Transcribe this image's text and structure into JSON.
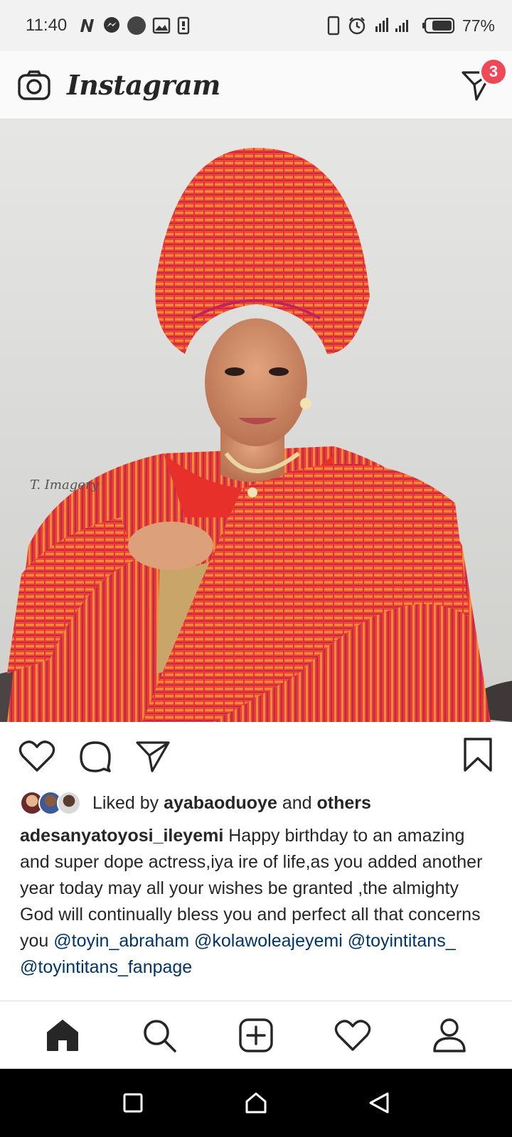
{
  "status_bar": {
    "time": "11:40",
    "notification_icons": [
      "netflix-icon",
      "messenger-icon",
      "circle-icon",
      "gallery-icon",
      "sim-icon"
    ],
    "system_icons": [
      "phone-icon",
      "alarm-icon",
      "signal-icon",
      "battery-icon"
    ],
    "battery_percent": "77%"
  },
  "header": {
    "app_name": "Instagram",
    "camera_icon": "camera-icon",
    "direct_icon": "direct-message-icon",
    "direct_badge": "3",
    "badge_color": "#ed4956"
  },
  "post": {
    "image_description_icon": "post-photo",
    "watermark": "T. Imagery"
  },
  "actions": {
    "like_icon": "heart-icon",
    "comment_icon": "comment-icon",
    "share_icon": "send-icon",
    "save_icon": "bookmark-icon"
  },
  "likes": {
    "prefix": "Liked by",
    "user": "ayabaoduoye",
    "middle": "and",
    "suffix": "others"
  },
  "caption": {
    "username": "adesanyatoyosi_ileyemi",
    "text": "Happy birthday to an amazing and super dope actress,iya ire of life,as you added another year today may all your wishes be granted ,the almighty God will continually bless you and perfect all that concerns you",
    "mentions": [
      "@toyin_abraham",
      "@kolawoleajeyemi",
      "@toyintitans_",
      "@toyintitans_fanpage"
    ],
    "mention_color": "#003569"
  },
  "bottom_nav": {
    "items": [
      "home-icon",
      "search-icon",
      "new-post-icon",
      "activity-icon",
      "profile-icon"
    ]
  },
  "system_nav": {
    "items": [
      "recents-icon",
      "home-button-icon",
      "back-icon"
    ]
  }
}
